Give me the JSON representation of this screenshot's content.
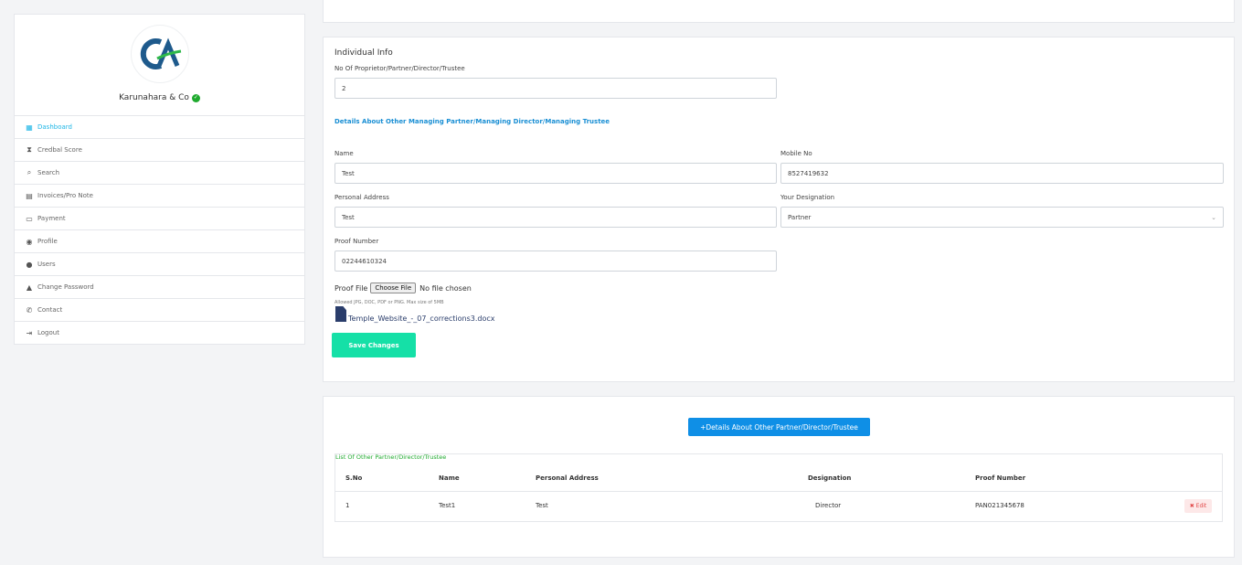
{
  "sidebar": {
    "firm_name": "Karunahara & Co",
    "logo_text": "CA",
    "items": [
      {
        "label": "Dashboard",
        "icon": "dashboard-icon",
        "glyph": "▦",
        "active": true
      },
      {
        "label": "Credbal Score",
        "icon": "hourglass-icon",
        "glyph": "⧗",
        "active": false
      },
      {
        "label": "Search",
        "icon": "search-icon",
        "glyph": "⌕",
        "active": false
      },
      {
        "label": "Invoices/Pro Note",
        "icon": "document-icon",
        "glyph": "▤",
        "active": false
      },
      {
        "label": "Payment",
        "icon": "credit-card-icon",
        "glyph": "▭",
        "active": false
      },
      {
        "label": "Profile",
        "icon": "user-gear-icon",
        "glyph": "◉",
        "active": false
      },
      {
        "label": "Users",
        "icon": "user-icon",
        "glyph": "●",
        "active": false
      },
      {
        "label": "Change Password",
        "icon": "lock-icon",
        "glyph": "▲",
        "active": false
      },
      {
        "label": "Contact",
        "icon": "phone-icon",
        "glyph": "✆",
        "active": false
      },
      {
        "label": "Logout",
        "icon": "logout-icon",
        "glyph": "⇥",
        "active": false
      }
    ]
  },
  "info": {
    "title": "Individual Info",
    "count_label": "No Of Proprietor/Partner/Director/Trustee",
    "count_value": "2",
    "section_heading": "Details About Other Managing Partner/Managing Director/Managing Trustee",
    "name_label": "Name",
    "name_value": "Test",
    "mobile_label": "Mobile No",
    "mobile_value": "8527419632",
    "address_label": "Personal Address",
    "address_value": "Test",
    "designation_label": "Your Designation",
    "designation_value": "Partner",
    "proof_label": "Proof Number",
    "proof_value": "02244610324",
    "proof_file_label": "Proof File",
    "choose_file": "Choose File",
    "no_file": "No file chosen",
    "file_hint": "Allowed JPG, DOC, PDF or PNG. Max size of 5MB",
    "uploaded_file": "Temple_Website_-_07_corrections3.docx",
    "save_label": "Save Changes"
  },
  "partners": {
    "add_label": "+Details About Other Partner/Director/Trustee",
    "list_heading": "List Of Other Partner/Director/Trustee",
    "headers": [
      "S.No",
      "Name",
      "Personal Address",
      "Designation",
      "Proof Number"
    ],
    "rows": [
      {
        "sno": "1",
        "name": "Test1",
        "address": "Test",
        "designation": "Director",
        "proof": "PAN021345678",
        "edit": "✖ Edit"
      }
    ]
  },
  "colors": {
    "accent": "#1fb6e6",
    "save": "#15e0a7",
    "primary_button": "#0f8fe6",
    "success": "#1faa2e",
    "danger": "#e24b4b"
  }
}
